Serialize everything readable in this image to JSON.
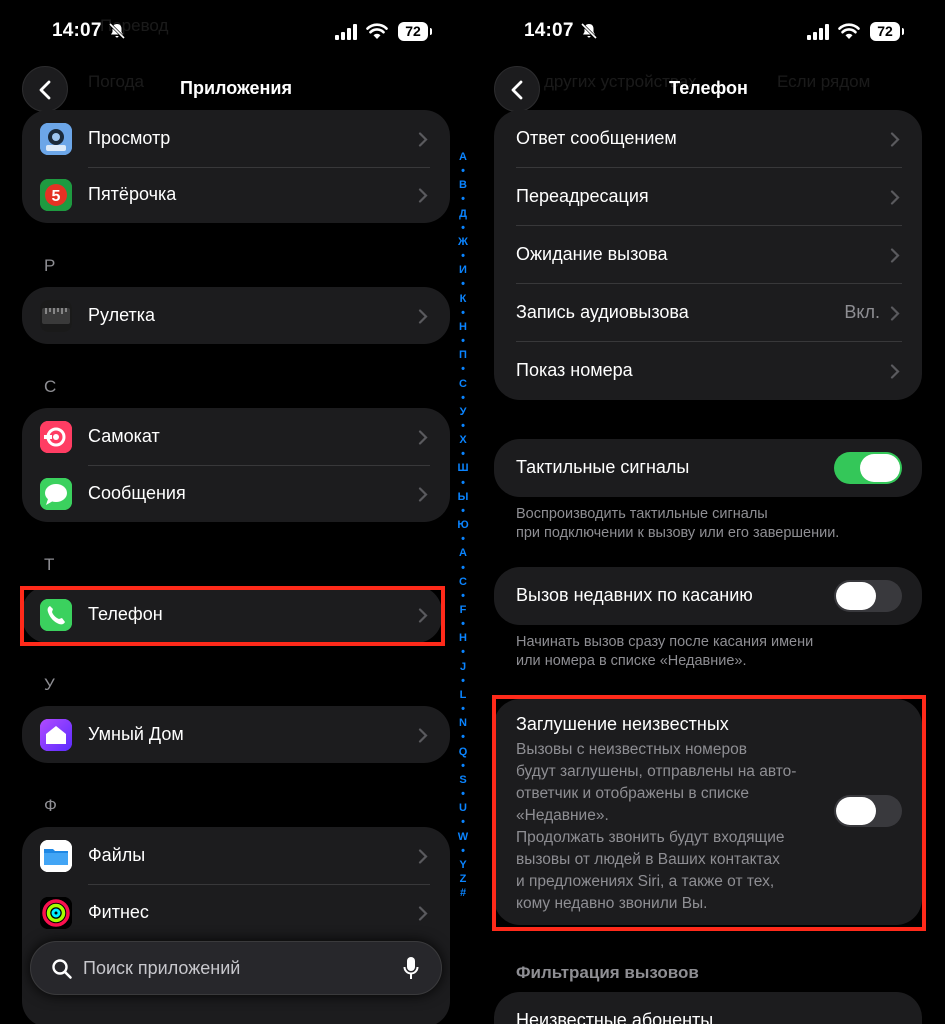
{
  "status": {
    "time": "14:07",
    "battery": "72"
  },
  "left": {
    "ghost_top": "Перевод",
    "ghost_row": "Погода",
    "title": "Приложения",
    "top_items": [
      {
        "label": "Просмотр",
        "icon": "preview-icon"
      },
      {
        "label": "Пятёрочка",
        "icon": "pyaterochka-icon"
      }
    ],
    "sections": [
      {
        "header": "Р",
        "items": [
          {
            "label": "Рулетка",
            "icon": "ruler-icon"
          }
        ]
      },
      {
        "header": "С",
        "items": [
          {
            "label": "Самокат",
            "icon": "samokat-icon"
          },
          {
            "label": "Сообщения",
            "icon": "messages-icon"
          }
        ]
      },
      {
        "header": "Т",
        "items": [
          {
            "label": "Телефон",
            "icon": "phone-icon"
          }
        ]
      },
      {
        "header": "У",
        "items": [
          {
            "label": "Умный Дом",
            "icon": "home-icon"
          }
        ]
      },
      {
        "header": "Ф",
        "items": [
          {
            "label": "Файлы",
            "icon": "files-icon"
          },
          {
            "label": "Фитнес",
            "icon": "fitness-icon"
          }
        ]
      }
    ],
    "index_letters": [
      "А",
      "•",
      "В",
      "•",
      "Д",
      "•",
      "Ж",
      "•",
      "И",
      "•",
      "К",
      "•",
      "Н",
      "•",
      "П",
      "•",
      "С",
      "•",
      "У",
      "•",
      "Х",
      "•",
      "Ш",
      "•",
      "Ы",
      "•",
      "Ю",
      "•",
      "A",
      "•",
      "C",
      "•",
      "F",
      "•",
      "H",
      "•",
      "J",
      "•",
      "L",
      "•",
      "N",
      "•",
      "Q",
      "•",
      "S",
      "•",
      "U",
      "•",
      "W",
      "•",
      "Y",
      "Z",
      "#"
    ],
    "search_placeholder": "Поиск приложений"
  },
  "right": {
    "ghost_left": "других устройствах",
    "ghost_right": "Если рядом",
    "title": "Телефон",
    "group1": [
      {
        "label": "Ответ сообщением"
      },
      {
        "label": "Переадресация"
      },
      {
        "label": "Ожидание вызова"
      },
      {
        "label": "Запись аудиовызова",
        "value": "Вкл."
      },
      {
        "label": "Показ номера"
      }
    ],
    "haptics": {
      "label": "Тактильные сигналы",
      "on": true,
      "footer": [
        "Воспроизводить тактильные сигналы",
        "при подключении к вызову или его завершении."
      ]
    },
    "tap_recents": {
      "label": "Вызов недавних по касанию",
      "on": false,
      "footer": [
        "Начинать вызов сразу после касания имени",
        "или номера в списке «Недавние»."
      ]
    },
    "silence": {
      "label": "Заглушение неизвестных",
      "on": false,
      "desc": [
        "Вызовы с неизвестных номеров",
        "будут заглушены, отправлены на авто-",
        "ответчик и отображены в списке",
        "«Недавние».",
        "Продолжать звонить будут входящие",
        "вызовы от людей в Ваших контактах",
        "и предложениях Siri, а также от тех,",
        "кому недавно звонили Вы."
      ]
    },
    "filter_header": "Фильтрация вызовов",
    "last_row": "Неизвестные абоненты"
  },
  "colors": {
    "accent": "#0a84ff",
    "switch_on": "#34c759",
    "highlight": "#ff2a1a"
  }
}
